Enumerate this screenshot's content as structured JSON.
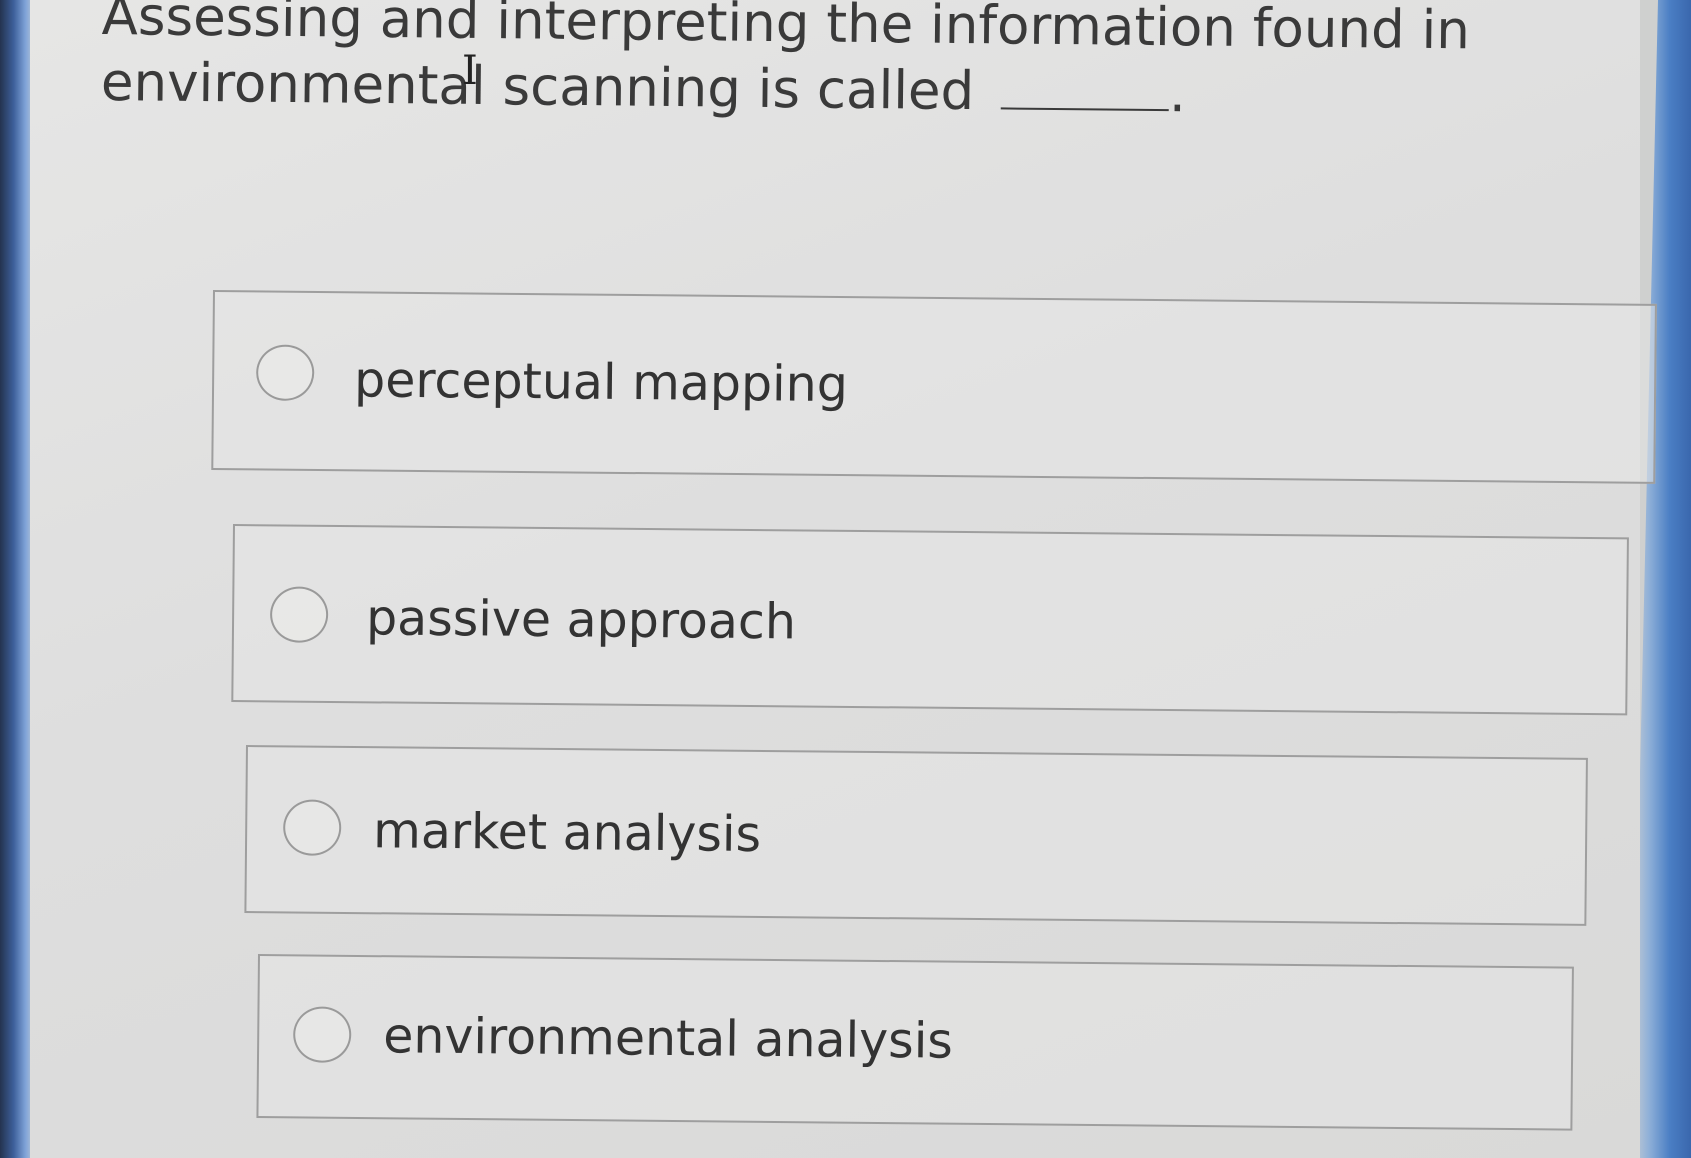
{
  "question": {
    "text": "Assessing and interpreting the information found in environmental scanning is called",
    "suffix": "."
  },
  "options": [
    {
      "label": "perceptual mapping",
      "selected": false
    },
    {
      "label": "passive approach",
      "selected": false
    },
    {
      "label": "market analysis",
      "selected": false
    },
    {
      "label": "environmental analysis",
      "selected": false
    }
  ]
}
